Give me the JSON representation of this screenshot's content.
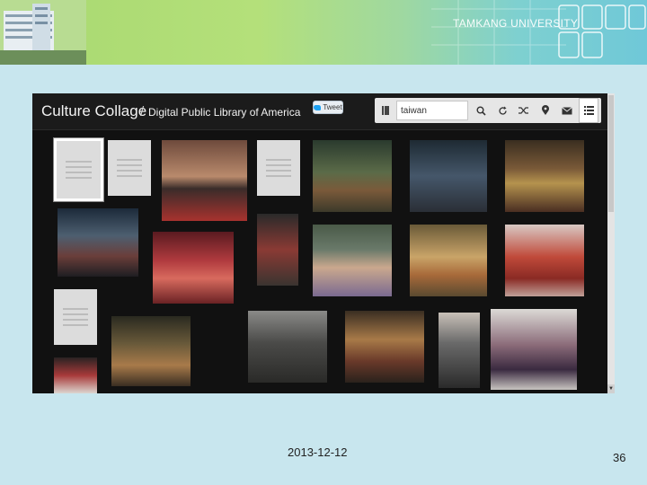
{
  "banner": {
    "university": "TAMKANG UNIVERSITY"
  },
  "app": {
    "title": "Culture Collage",
    "separator": "/",
    "subtitle": "Digital Public Library of America",
    "tweet_label": "Tweet"
  },
  "toolbar": {
    "search_value": "taiwan",
    "icons": [
      "book-icon",
      "search-icon",
      "refresh-icon",
      "shuffle-icon",
      "location-pin-icon",
      "mail-icon",
      "list-icon"
    ]
  },
  "footer": {
    "date": "2013-12-12",
    "page": "36"
  },
  "colors": {
    "background": "#c8e6ee",
    "banner_green": "#a8d870",
    "banner_teal": "#6fc8d8",
    "app_bg": "#111111"
  }
}
